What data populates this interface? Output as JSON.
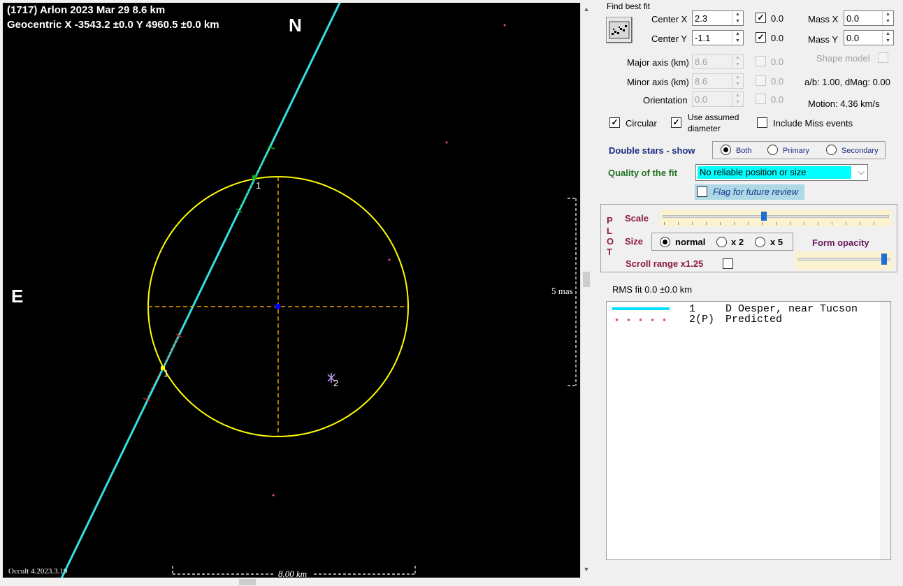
{
  "plot": {
    "title_line1": "(1717) Arlon  2023 Mar 29   8.6 km",
    "title_line2": "Geocentric  X  -3543.2 ±0.0  Y 4960.5 ±0.0 km",
    "north_label": "N",
    "east_label": "E",
    "scale_mas_label": "5 mas",
    "scale_km_label": "8.00 km",
    "version_label": "Occult 4.2023.3.19",
    "chord_label_1": "1",
    "chord_label_1b": "1",
    "predicted_label_2": "2",
    "colors": {
      "background": "#000000",
      "ellipse": "#ffff00",
      "axes": "#e8a000",
      "chord": "#33e0e0",
      "predicted": "#e05080",
      "center": "#0000ff"
    }
  },
  "panel": {
    "find_best_fit_label": "Find best fit",
    "find_best_fit_icon": "fit-chart-icon",
    "center_x": {
      "label": "Center X",
      "value": "2.3",
      "check_value": "0.0",
      "checked": true
    },
    "center_y": {
      "label": "Center Y",
      "value": "-1.1",
      "check_value": "0.0",
      "checked": true
    },
    "mass_x": {
      "label": "Mass X",
      "value": "0.0"
    },
    "mass_y": {
      "label": "Mass Y",
      "value": "0.0"
    },
    "major_axis": {
      "label": "Major axis (km)",
      "value": "8.6",
      "check_value": "0.0"
    },
    "minor_axis": {
      "label": "Minor axis (km)",
      "value": "8.6",
      "check_value": "0.0"
    },
    "orientation": {
      "label": "Orientation",
      "value": "0.0",
      "check_value": "0.0"
    },
    "shape_model_label": "Shape model",
    "ab_dmag": "a/b: 1.00, dMag: 0.00",
    "motion": "Motion: 4.36 km/s",
    "circular_label": "Circular",
    "use_assumed_label_1": "Use assumed",
    "use_assumed_label_2": "diameter",
    "include_miss_label": "Include Miss events",
    "double_stars_label": "Double stars - show",
    "ds_both": "Both",
    "ds_primary": "Primary",
    "ds_secondary": "Secondary",
    "quality_label": "Quality of the fit",
    "quality_value": "No reliable position or size",
    "flag_label": "Flag for future review",
    "plot_group_letters": [
      "P",
      "L",
      "O",
      "T"
    ],
    "scale_label": "Scale",
    "size_label": "Size",
    "size_normal": "normal",
    "size_x2": "x 2",
    "size_x5": "x 5",
    "form_opacity_label": "Form opacity",
    "scroll_range_label": "Scroll range x1.25",
    "rms_fit": "RMS fit  0.0 ±0.0 km",
    "legend": [
      {
        "id": "1",
        "text": "D Oesper, near Tucson",
        "style": "solid"
      },
      {
        "id": "2(P)",
        "text": "Predicted",
        "style": "dotted"
      }
    ]
  }
}
